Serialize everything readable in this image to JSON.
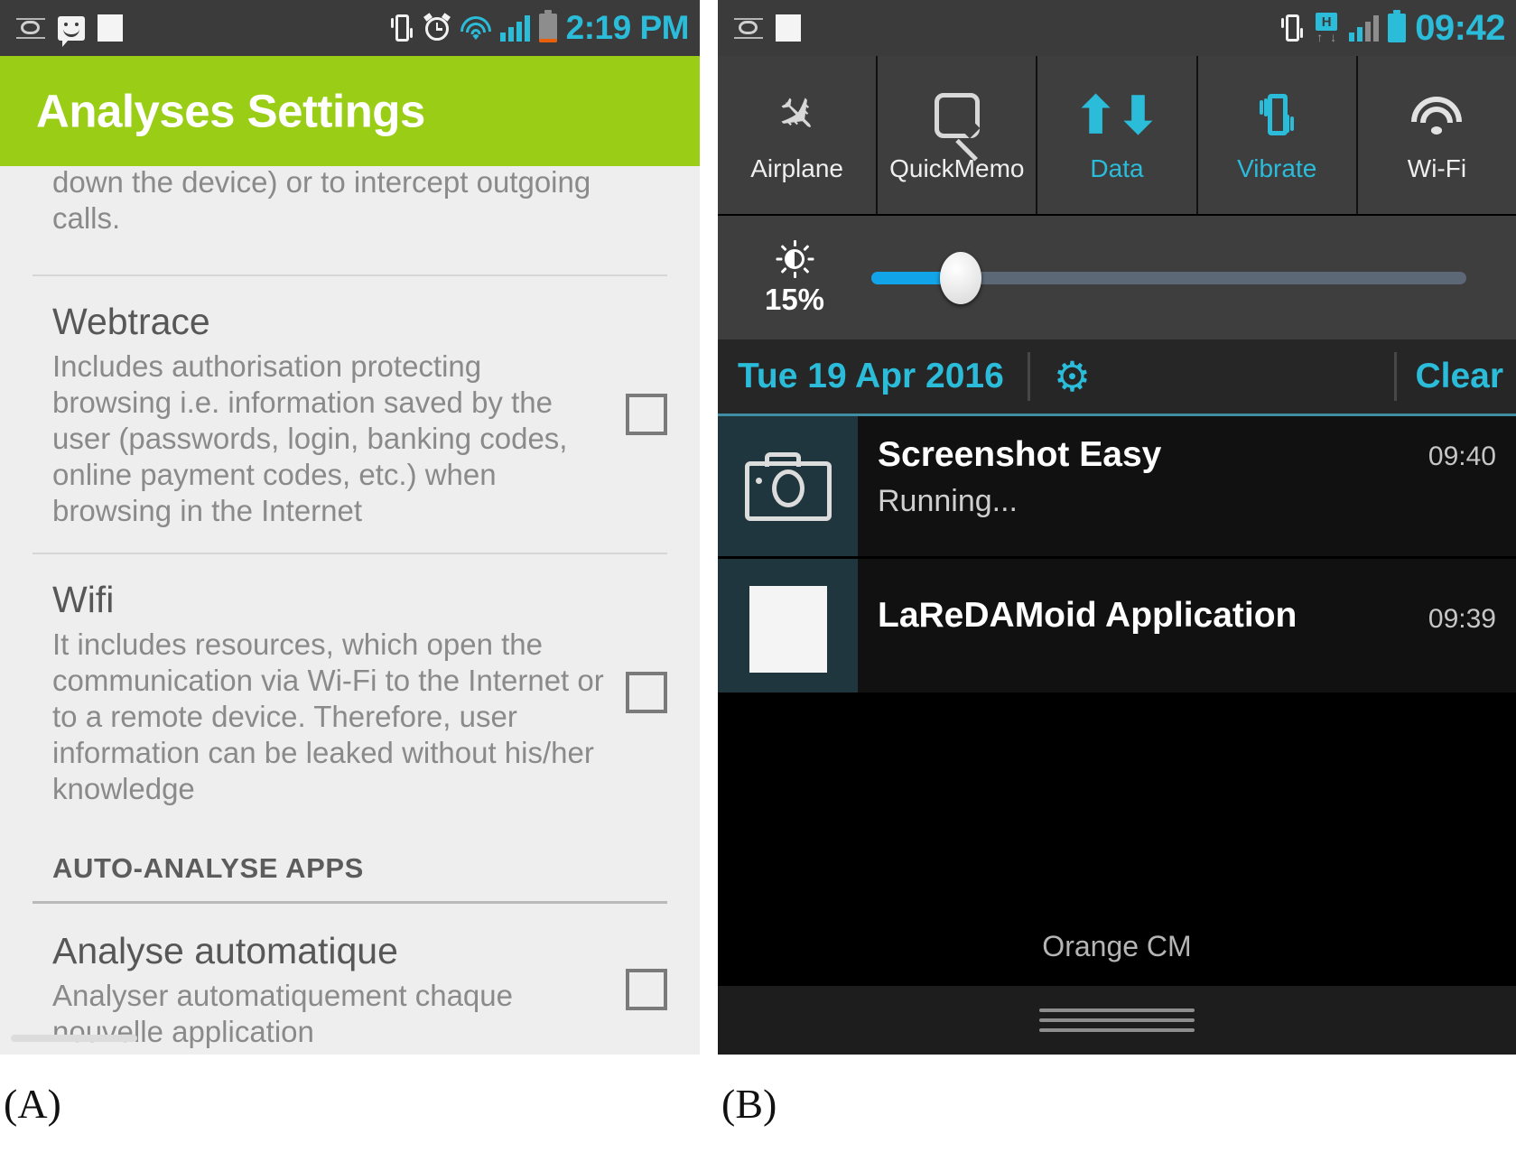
{
  "figure": {
    "label_a": "(A)",
    "label_b": "(B)"
  },
  "panel_a": {
    "status_bar": {
      "icons_left": [
        "screenshot-icon",
        "message-smiley-icon",
        "shield-warning-icon"
      ],
      "icons_right": [
        "vibrate-icon",
        "alarm-icon",
        "wifi-icon",
        "signal-icon",
        "battery-icon"
      ],
      "clock": "2:19 PM"
    },
    "action_bar": {
      "title": "Analyses Settings",
      "color": "#9ACD15"
    },
    "settings": {
      "clipped_top_text": "modify the phone state (such as to shut down the device) or to intercept outgoing calls.",
      "items": [
        {
          "title": "Webtrace",
          "description": "Includes authorisation protecting browsing i.e. information saved by the user (passwords, login, banking codes, online payment codes, etc.) when browsing in the Internet",
          "checked": false
        },
        {
          "title": "Wifi",
          "description": "It includes resources, which open the communication via Wi-Fi to the Internet or to a remote device. Therefore, user information can be leaked without his/her knowledge",
          "checked": false
        }
      ],
      "section_header": "AUTO-ANALYSE APPS",
      "auto_items": [
        {
          "title": "Analyse automatique",
          "description": "Analyser automatiquement chaque nouvelle application",
          "checked": false
        }
      ]
    }
  },
  "panel_b": {
    "status_bar": {
      "icons_left": [
        "screenshot-icon",
        "shield-warning-icon"
      ],
      "icons_right": [
        "vibrate-icon",
        "hspa-data-icon",
        "signal-icon",
        "battery-icon"
      ],
      "clock": "09:42"
    },
    "quick_toggles": [
      {
        "label": "Airplane",
        "icon": "airplane-icon",
        "active": false
      },
      {
        "label": "QuickMemo",
        "icon": "quickmemo-icon",
        "active": false
      },
      {
        "label": "Data",
        "icon": "data-arrows-icon",
        "active": true
      },
      {
        "label": "Vibrate",
        "icon": "vibrate-icon",
        "active": true
      },
      {
        "label": "Wi-Fi",
        "icon": "wifi-icon",
        "active": false
      }
    ],
    "brightness": {
      "icon": "brightness-sun-icon",
      "percent": "15%",
      "value": 15
    },
    "notification_header": {
      "date": "Tue 19 Apr 2016",
      "settings_icon": "gear-icon",
      "clear_label": "Clear"
    },
    "notifications": [
      {
        "icon": "camera-icon",
        "title": "Screenshot Easy",
        "subtitle": "Running...",
        "time": "09:40"
      },
      {
        "icon": "shield-warning-icon",
        "title": "LaReDAMoid Application",
        "subtitle": "",
        "time": "09:39"
      }
    ],
    "carrier": "Orange CM",
    "drag_handle": "notification-drag-handle"
  }
}
